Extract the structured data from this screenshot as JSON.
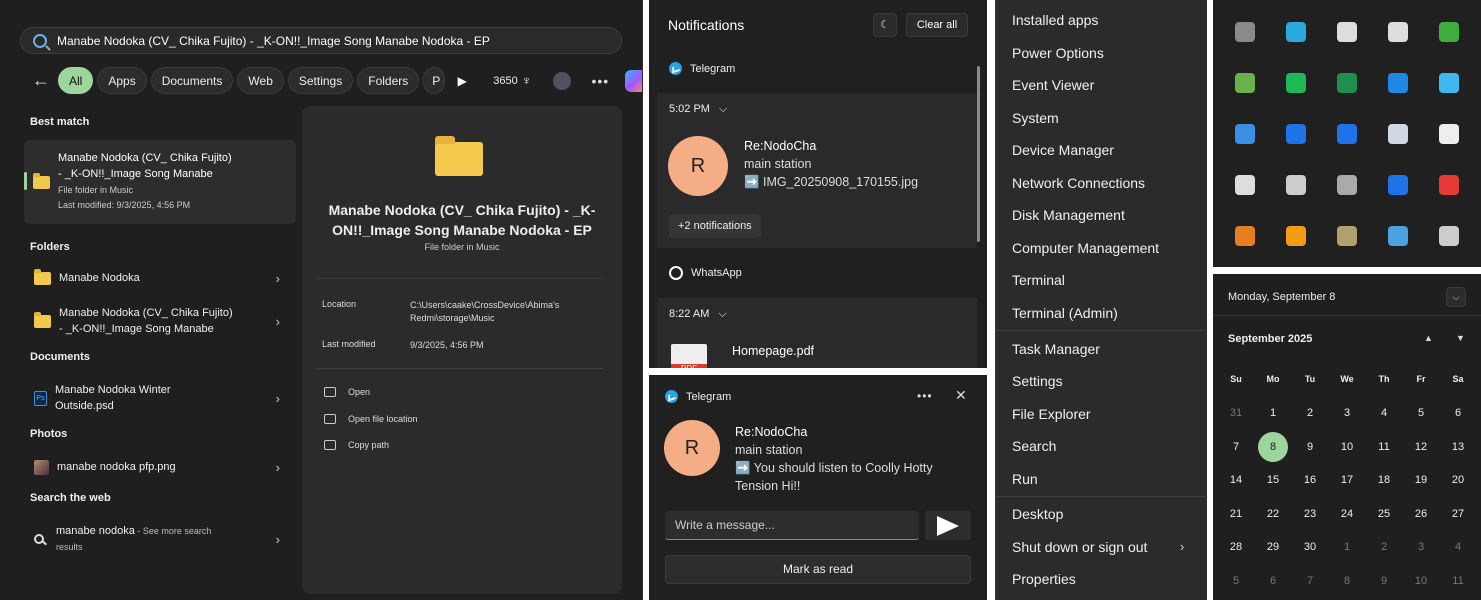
{
  "search": {
    "query": "Manabe Nodoka (CV_ Chika Fujito) - _K-ON!!_Image Song Manabe Nodoka - EP",
    "filters": [
      "All",
      "Apps",
      "Documents",
      "Web",
      "Settings",
      "Folders",
      "P"
    ],
    "score": "3650",
    "best_match_header": "Best match",
    "best_match": {
      "line1": "Manabe Nodoka (CV_ Chika Fujito)",
      "line2": "- _K-ON!!_Image Song Manabe",
      "type": "File folder in Music",
      "modified": "Last modified: 9/3/2025, 4:56 PM"
    },
    "folders_header": "Folders",
    "folders": [
      {
        "line1": "Manabe Nodoka",
        "line2": ""
      },
      {
        "line1": "Manabe Nodoka (CV_ Chika Fujito)",
        "line2": "- _K-ON!!_Image Song Manabe"
      }
    ],
    "documents_header": "Documents",
    "document": {
      "line1": "Manabe Nodoka Winter",
      "line2": "Outside.psd"
    },
    "photos_header": "Photos",
    "photo": "manabe nodoka pfp.png",
    "web_header": "Search the web",
    "web": {
      "query": "manabe nodoka",
      "hint": " - See more search",
      "hint2": "results"
    },
    "preview": {
      "title": "Manabe Nodoka (CV_ Chika Fujito) - _K-ON!!_Image Song Manabe Nodoka - EP",
      "subtitle": "File folder in Music",
      "location_label": "Location",
      "location_value": "C:\\Users\\caake\\CrossDevice\\Abima's Redmi\\storage\\Music",
      "modified_label": "Last modified",
      "modified_value": "9/3/2025, 4:56 PM",
      "actions": [
        "Open",
        "Open file location",
        "Copy path"
      ]
    }
  },
  "notifications": {
    "title": "Notifications",
    "clear_all": "Clear all",
    "telegram_app": "Telegram",
    "tg_time": "5:02 PM",
    "tg_avatar": "R",
    "tg_sender": "Re:NodoCha",
    "tg_line2": "main station",
    "tg_line3": "➡️ IMG_20250908_170155.jpg",
    "more": "+2 notifications",
    "whatsapp_app": "WhatsApp",
    "wa_time": "8:22 AM",
    "wa_file": "Homepage.pdf"
  },
  "toast": {
    "app": "Telegram",
    "avatar": "R",
    "sender": "Re:NodoCha",
    "line2": "main station",
    "line3": "➡️ You should listen to Coolly Hotty",
    "line4": "Tension Hi!!",
    "placeholder": "Write a message...",
    "mark_read": "Mark as read"
  },
  "winx_menu": {
    "items": [
      "Installed apps",
      "Power Options",
      "Event Viewer",
      "System",
      "Device Manager",
      "Network Connections",
      "Disk Management",
      "Computer Management",
      "Terminal",
      "Terminal (Admin)",
      "Task Manager",
      "Settings",
      "File Explorer",
      "Search",
      "Run",
      "Desktop",
      "Shut down or sign out",
      "Properties"
    ]
  },
  "tray": {
    "icons": [
      {
        "name": "app-icon",
        "color": "#8a8a8a"
      },
      {
        "name": "edge-dev-icon",
        "color": "#2aa8e0"
      },
      {
        "name": "figma-icon",
        "color": "#dddddd"
      },
      {
        "name": "yahoo-icon",
        "color": "#dddddd"
      },
      {
        "name": "play-icon",
        "color": "#3fae3f"
      },
      {
        "name": "nvidia-icon",
        "color": "#6ab04c"
      },
      {
        "name": "spotify-icon",
        "color": "#1db954"
      },
      {
        "name": "excel-icon",
        "color": "#1f8f4e"
      },
      {
        "name": "defender-icon",
        "color": "#1e88e5"
      },
      {
        "name": "window-icon",
        "color": "#3fb8f0"
      },
      {
        "name": "explorer-icon",
        "color": "#3a8ee6"
      },
      {
        "name": "bluetooth-icon",
        "color": "#1e73e8"
      },
      {
        "name": "virtual-desktop-icon",
        "color": "#1e73e8"
      },
      {
        "name": "steam-icon",
        "color": "#cfd8e3"
      },
      {
        "name": "cursor-icon",
        "color": "#eeeeee"
      },
      {
        "name": "discord-icon",
        "color": "#dddddd"
      },
      {
        "name": "cloud-icon",
        "color": "#cccccc"
      },
      {
        "name": "camera-icon",
        "color": "#aaaaaa"
      },
      {
        "name": "arrow-up-icon",
        "color": "#1e73e8"
      },
      {
        "name": "bars-icon",
        "color": "#e53935"
      },
      {
        "name": "key-icon",
        "color": "#e67e22"
      },
      {
        "name": "alert-icon",
        "color": "#f39c12"
      },
      {
        "name": "screen-icon",
        "color": "#b0a070"
      },
      {
        "name": "gamepad-icon",
        "color": "#4aa3e0"
      },
      {
        "name": "telegram-icon",
        "color": "#cccccc"
      }
    ]
  },
  "calendar": {
    "header": "Monday, September 8",
    "month": "September 2025",
    "dow": [
      "Su",
      "Mo",
      "Tu",
      "We",
      "Th",
      "Fr",
      "Sa"
    ],
    "weeks": [
      [
        "31",
        "1",
        "2",
        "3",
        "4",
        "5",
        "6"
      ],
      [
        "7",
        "8",
        "9",
        "10",
        "11",
        "12",
        "13"
      ],
      [
        "14",
        "15",
        "16",
        "17",
        "18",
        "19",
        "20"
      ],
      [
        "21",
        "22",
        "23",
        "24",
        "25",
        "26",
        "27"
      ],
      [
        "28",
        "29",
        "30",
        "1",
        "2",
        "3",
        "4"
      ],
      [
        "5",
        "6",
        "7",
        "8",
        "9",
        "10",
        "11"
      ]
    ],
    "today": "8",
    "accent": "#9dd69a"
  }
}
